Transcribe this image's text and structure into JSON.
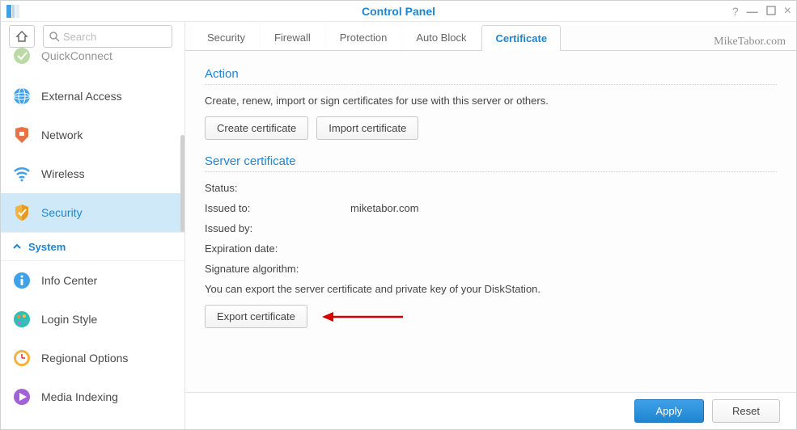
{
  "titlebar": {
    "title": "Control Panel"
  },
  "search": {
    "placeholder": "Search"
  },
  "watermark": "MikeTabor.com",
  "sidebar": {
    "items_top": [
      {
        "label": "QuickConnect"
      },
      {
        "label": "External Access"
      },
      {
        "label": "Network"
      },
      {
        "label": "Wireless"
      },
      {
        "label": "Security"
      }
    ],
    "section": "System",
    "items_bottom": [
      {
        "label": "Info Center"
      },
      {
        "label": "Login Style"
      },
      {
        "label": "Regional Options"
      },
      {
        "label": "Media Indexing"
      }
    ]
  },
  "tabs": [
    "Security",
    "Firewall",
    "Protection",
    "Auto Block",
    "Certificate"
  ],
  "action": {
    "title": "Action",
    "desc": "Create, renew, import or sign certificates for use with this server or others.",
    "create": "Create certificate",
    "import": "Import certificate"
  },
  "server": {
    "title": "Server certificate",
    "status_k": "Status:",
    "status_v": "",
    "issued_to_k": "Issued to:",
    "issued_to_v": "miketabor.com",
    "issued_by_k": "Issued by:",
    "issued_by_v": "",
    "exp_k": "Expiration date:",
    "exp_v": "",
    "sig_k": "Signature algorithm:",
    "sig_v": "",
    "export_desc": "You can export the server certificate and private key of your DiskStation.",
    "export_btn": "Export certificate"
  },
  "footer": {
    "apply": "Apply",
    "reset": "Reset"
  }
}
